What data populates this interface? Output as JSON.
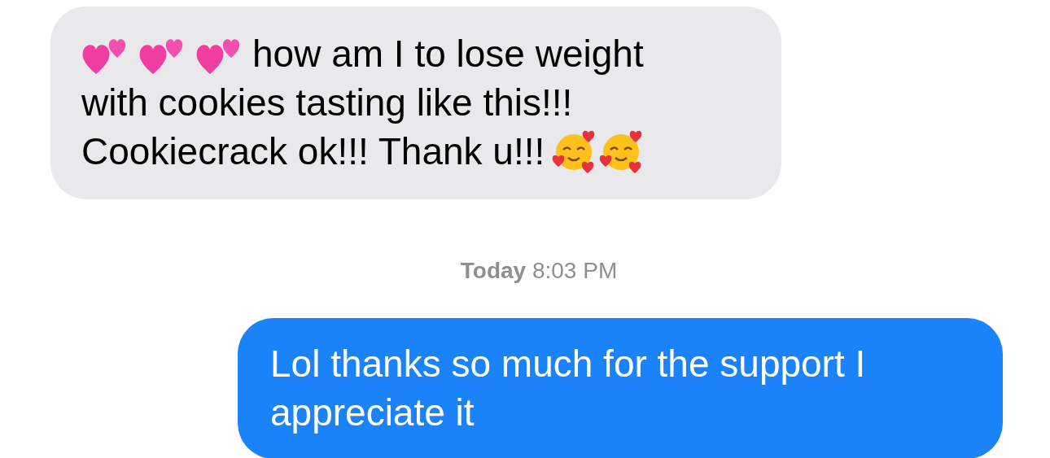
{
  "messages": [
    {
      "kind": "incoming",
      "lines": [
        [
          {
            "kind": "hearts"
          },
          {
            "kind": "hearts"
          },
          {
            "kind": "hearts"
          },
          {
            "kind": "text",
            "text": "how am I to lose weight"
          }
        ],
        [
          {
            "kind": "text",
            "text": "with cookies tasting like this!!!"
          }
        ],
        [
          {
            "kind": "text",
            "text": "Cookiecrack ok!!! Thank u!!!"
          },
          {
            "kind": "face"
          },
          {
            "kind": "face"
          }
        ]
      ]
    },
    {
      "kind": "timestamp",
      "lines": [
        [
          {
            "kind": "text",
            "text": "**Today** 8:03 PM"
          }
        ]
      ]
    },
    {
      "kind": "outgoing",
      "lines": [
        [
          {
            "kind": "text",
            "text": "Lol thanks so much for the support I appreciate it"
          }
        ]
      ]
    }
  ]
}
